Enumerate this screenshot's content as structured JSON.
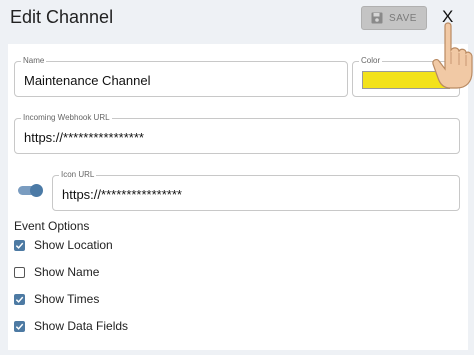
{
  "header": {
    "title": "Edit Channel",
    "save_label": "SAVE",
    "close_label": "X"
  },
  "form": {
    "name": {
      "label": "Name",
      "value": "Maintenance Channel"
    },
    "color": {
      "label": "Color",
      "value": "#f3e21a"
    },
    "webhook": {
      "label": "Incoming Webhook URL",
      "value": "https://****************"
    },
    "icon": {
      "label": "Icon URL",
      "value": "https://****************",
      "enabled": true
    }
  },
  "event_options": {
    "label": "Event Options",
    "items": [
      {
        "label": "Show Location",
        "checked": true
      },
      {
        "label": "Show Name",
        "checked": false
      },
      {
        "label": "Show Times",
        "checked": true
      },
      {
        "label": "Show Data Fields",
        "checked": true
      }
    ]
  },
  "colors": {
    "accent": "#4d7aa3",
    "save_disabled": "#c4c4c4",
    "swatch": "#f3e21a"
  }
}
